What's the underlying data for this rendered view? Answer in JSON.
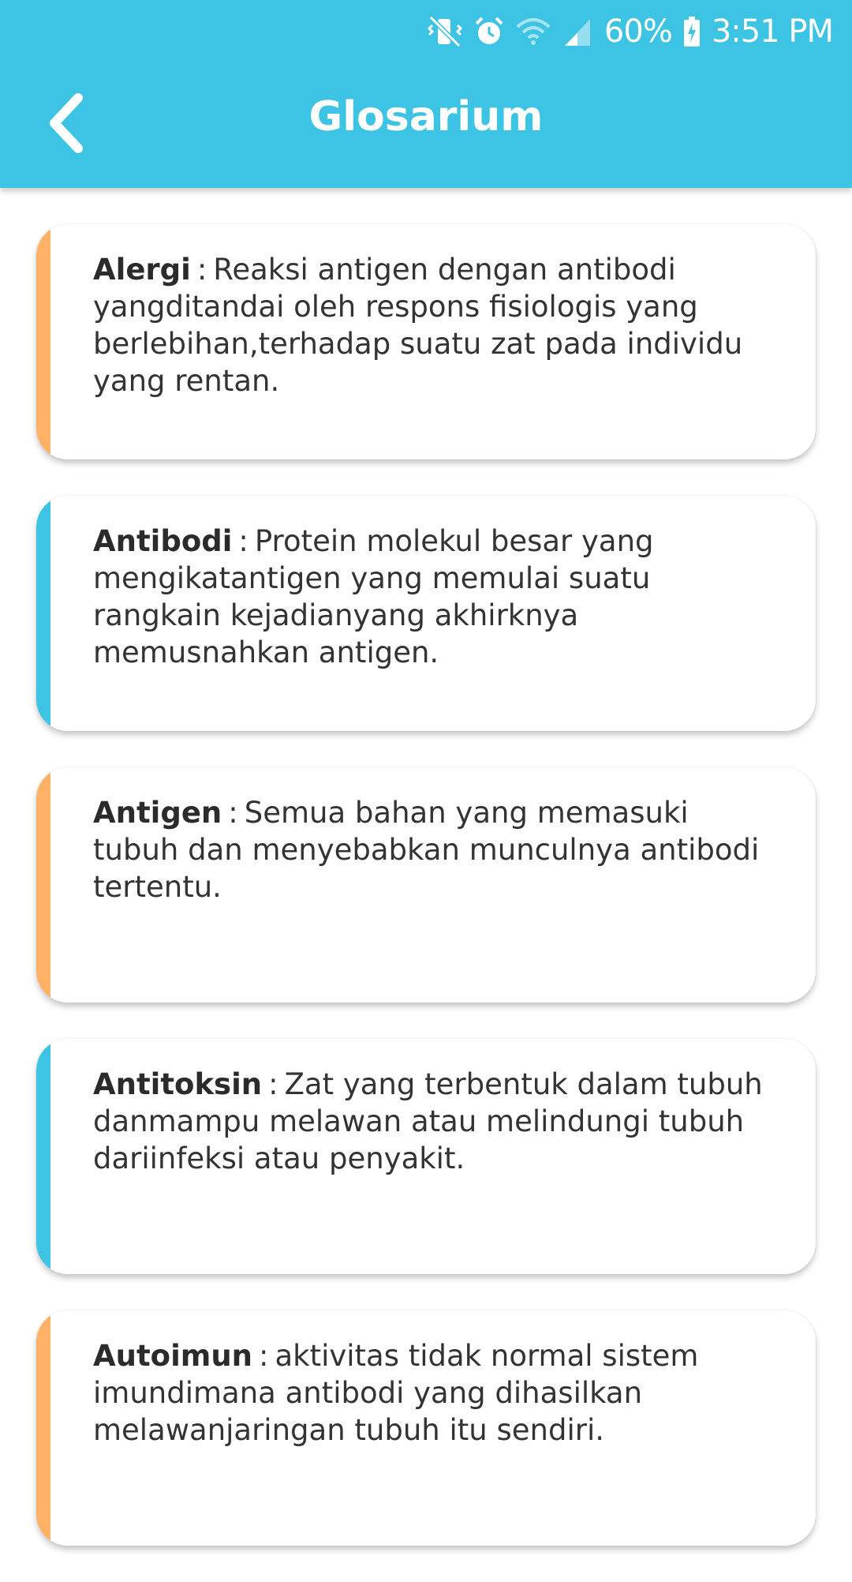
{
  "status_bar": {
    "battery": "60%",
    "time": "3:51 PM",
    "icons": [
      "vibrate-mute-icon",
      "alarm-icon",
      "wifi-icon",
      "signal-icon",
      "battery-charging-icon"
    ]
  },
  "header": {
    "title": "Glosarium",
    "back_icon": "chevron-left-icon"
  },
  "colors": {
    "primary": "#3dc3e3",
    "accent_orange": "#ffb266",
    "accent_blue": "#3dc3e3"
  },
  "glossary": [
    {
      "term": "Alergi",
      "sep": ":",
      "definition": "Reaksi antigen dengan antibodi yangditandai oleh respons fisiologis yang berlebihan,terhadap suatu zat pada individu yang rentan.",
      "accent": "orange"
    },
    {
      "term": "Antibodi",
      "sep": ":",
      "definition": "Protein molekul besar yang mengikatantigen yang memulai suatu rangkain kejadianyang akhirknya memusnahkan antigen.",
      "accent": "blue"
    },
    {
      "term": "Antigen",
      "sep": ":",
      "definition": "Semua bahan yang memasuki tubuh dan menyebabkan munculnya antibodi tertentu.",
      "accent": "orange"
    },
    {
      "term": "Antitoksin",
      "sep": ":",
      "definition": "Zat yang terbentuk dalam tubuh danmampu melawan atau melindungi tubuh dariinfeksi atau penyakit.",
      "accent": "blue"
    },
    {
      "term": "Autoimun",
      "sep": ":",
      "definition": "aktivitas tidak normal sistem imundimana antibodi yang dihasilkan melawanjaringan tubuh itu sendiri.",
      "accent": "orange"
    }
  ]
}
